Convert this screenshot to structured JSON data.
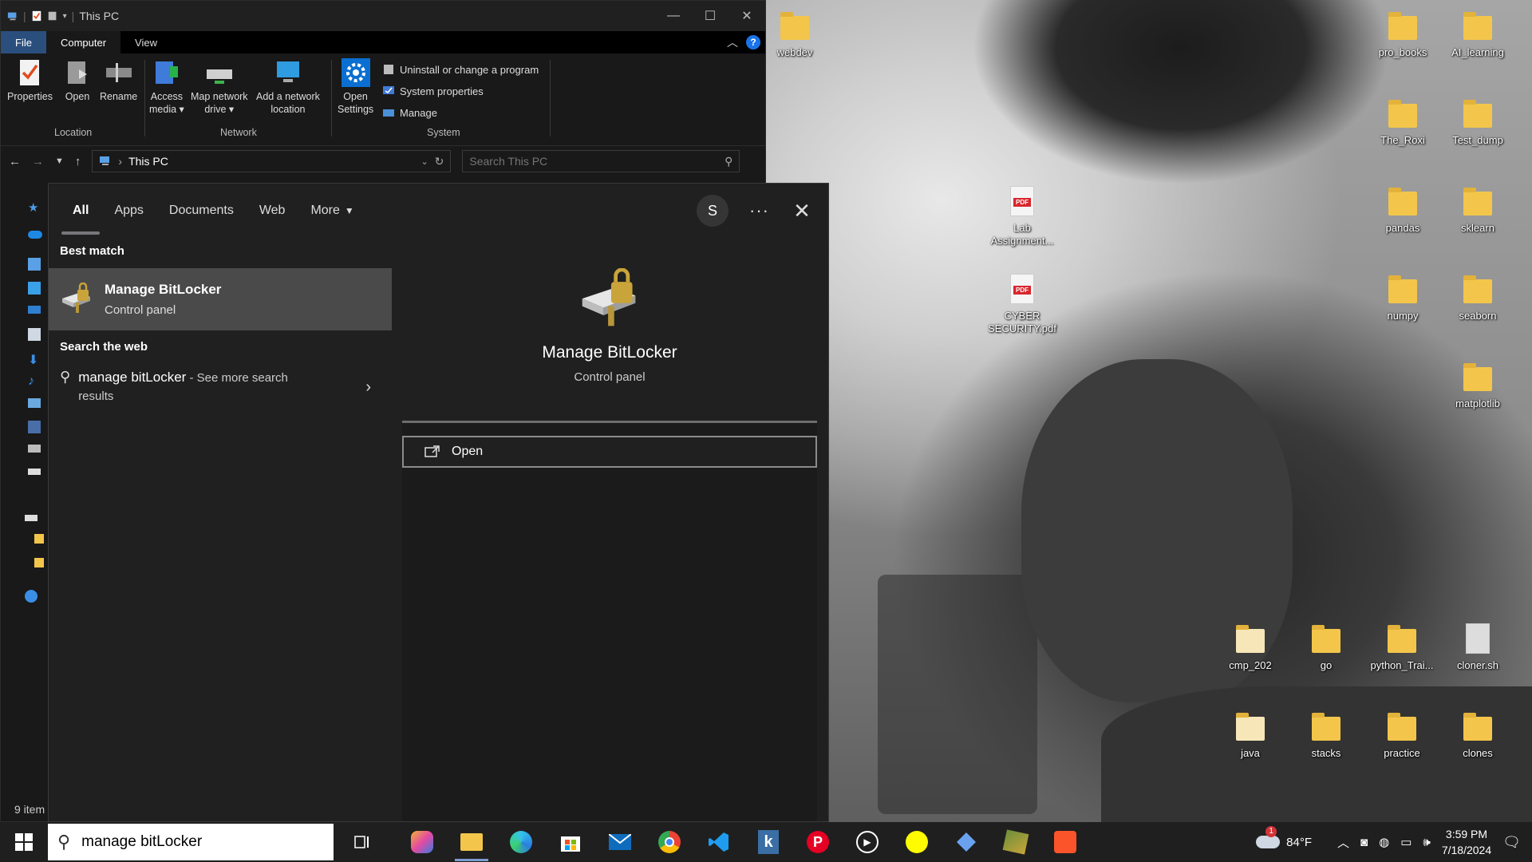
{
  "explorer": {
    "title": "This PC",
    "ribbon_tabs": [
      "File",
      "Computer",
      "View"
    ],
    "location_group": {
      "label": "Location",
      "buttons": [
        "Properties",
        "Open",
        "Rename"
      ]
    },
    "network_group": {
      "label": "Network",
      "access_media": [
        "Access",
        "media ▾"
      ],
      "map_drive": [
        "Map network",
        "drive ▾"
      ],
      "add_location": [
        "Add a network",
        "location"
      ]
    },
    "system_group": {
      "label": "System",
      "open_settings": [
        "Open",
        "Settings"
      ],
      "uninstall": "Uninstall or change a program",
      "system_properties": "System properties",
      "manage": "Manage"
    },
    "address": "This PC",
    "search_placeholder": "Search This PC",
    "status": "9 item"
  },
  "search_panel": {
    "tabs": [
      "All",
      "Apps",
      "Documents",
      "Web",
      "More"
    ],
    "avatar_letter": "S",
    "best_match_title": "Best match",
    "best_match": {
      "name": "Manage BitLocker",
      "type": "Control panel"
    },
    "web_title": "Search the web",
    "web_query": "manage bitLocker",
    "web_suffix": " - See more search results",
    "preview": {
      "name": "Manage BitLocker",
      "type": "Control panel"
    },
    "open_label": "Open"
  },
  "desktop_icons": [
    {
      "label": "webdev",
      "kind": "folder"
    },
    {
      "label": "pro_books",
      "kind": "folder"
    },
    {
      "label": "AI_learning",
      "kind": "folder"
    },
    {
      "label": "The_Roxi",
      "kind": "folder"
    },
    {
      "label": "Test_dump",
      "kind": "folder"
    },
    {
      "label": "Lab Assignment...",
      "kind": "pdf"
    },
    {
      "label": "pandas",
      "kind": "folder"
    },
    {
      "label": "sklearn",
      "kind": "folder"
    },
    {
      "label": "CYBER SECURITY.pdf",
      "kind": "pdf"
    },
    {
      "label": "numpy",
      "kind": "folder"
    },
    {
      "label": "seaborn",
      "kind": "folder"
    },
    {
      "label": "matplotlib",
      "kind": "folder"
    },
    {
      "label": "cmp_202",
      "kind": "folder"
    },
    {
      "label": "go",
      "kind": "folder"
    },
    {
      "label": "python_Trai...",
      "kind": "folder"
    },
    {
      "label": "cloner.sh",
      "kind": "file"
    },
    {
      "label": "java",
      "kind": "folder"
    },
    {
      "label": "stacks",
      "kind": "folder"
    },
    {
      "label": "practice",
      "kind": "folder"
    },
    {
      "label": "clones",
      "kind": "folder"
    }
  ],
  "taskbar": {
    "search_text": "manage bitLocker",
    "apps": [
      "copilot",
      "file-explorer",
      "edge",
      "store",
      "mail",
      "chrome",
      "vscode",
      "kotlin",
      "pinterest",
      "media-player",
      "snapchat",
      "bing",
      "games",
      "brave"
    ],
    "weather": "84°F",
    "weather_badge": "1",
    "time": "3:59 PM",
    "date": "7/18/2024"
  },
  "colors": {
    "file_tab": "#2a4f7d",
    "selected_item": "#4a4a4a",
    "panel_bg": "#202020",
    "taskbar_bg": "#1f1f1f"
  }
}
